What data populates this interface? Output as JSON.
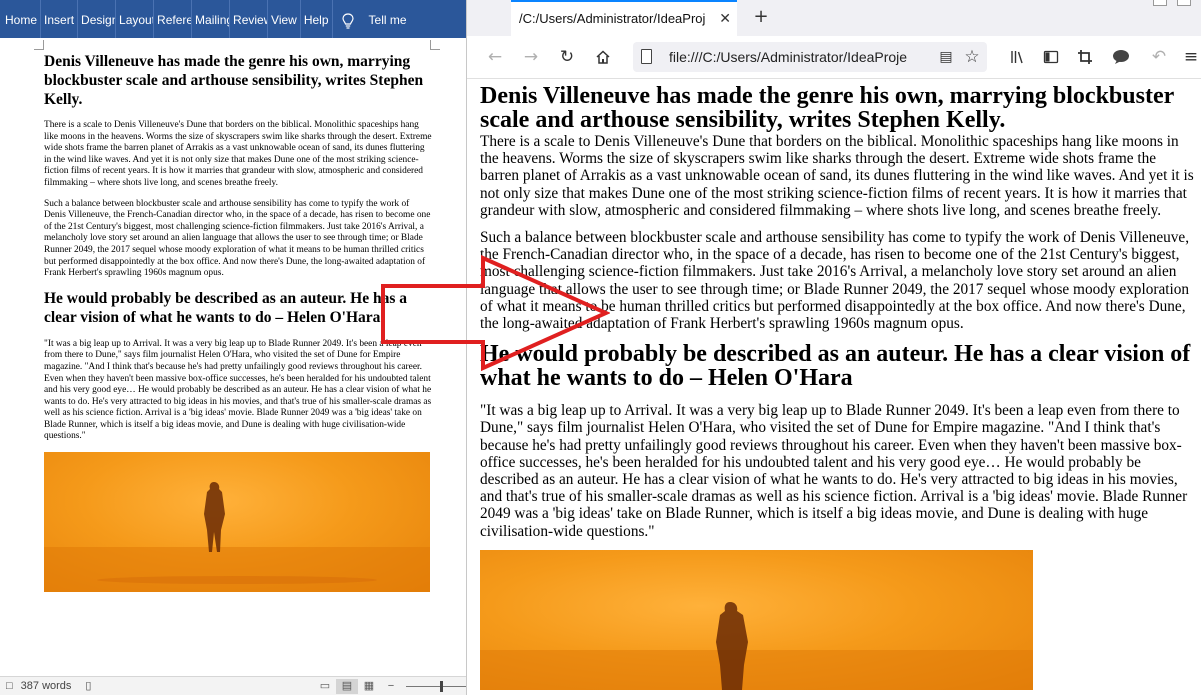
{
  "word": {
    "ribbon_tabs": [
      "Home",
      "Insert",
      "Design",
      "Layout",
      "References",
      "Mailings",
      "Review",
      "View",
      "Help"
    ],
    "tell_me": "Tell me",
    "heading1": "Denis Villeneuve has made the genre his own, marrying blockbuster scale and arthouse sensibility, writes Stephen Kelly.",
    "para1": "There is a scale to Denis Villeneuve's Dune that borders on the biblical. Monolithic spaceships hang like moons in the heavens. Worms the size of skyscrapers swim like sharks through the desert. Extreme wide shots frame the barren planet of Arrakis as a vast unknowable ocean of sand, its dunes fluttering in the wind like waves. And yet it is not only size that makes Dune one of the most striking science-fiction films of recent years. It is how it marries that grandeur with slow, atmospheric and considered filmmaking – where shots live long, and scenes breathe freely.",
    "para2": "Such a balance between blockbuster scale and arthouse sensibility has come to typify the work of Denis Villeneuve, the French-Canadian director who, in the space of a decade, has risen to become one of the 21st Century's biggest, most challenging science-fiction filmmakers. Just take 2016's Arrival, a melancholy love story set around an alien language that allows the user to see through time; or Blade Runner 2049, the 2017 sequel whose moody exploration of what it means to be human thrilled critics but performed disappointedly at the box office. And now there's Dune, the long-awaited adaptation of Frank Herbert's sprawling 1960s magnum opus.",
    "heading2": "He would probably be described as an auteur. He has a clear vision of what he wants to do – Helen O'Hara",
    "para3": "\"It was a big leap up to Arrival. It was a very big leap up to Blade Runner 2049. It's been a leap even from there to Dune,\" says film journalist Helen O'Hara, who visited the set of Dune for Empire magazine. \"And I think that's because he's had pretty unfailingly good reviews throughout his career. Even when they haven't been massive box-office successes, he's been heralded for his undoubted talent and his very good eye… He would probably be described as an auteur. He has a clear vision of what he wants to do. He's very attracted to big ideas in his movies, and that's true of his smaller-scale dramas as well as his science fiction. Arrival is a 'big ideas' movie. Blade Runner 2049 was a 'big ideas' take on Blade Runner, which is itself a big ideas movie, and Dune is dealing with huge civilisation-wide questions.\"",
    "status_words": "387 words"
  },
  "browser": {
    "tab_title": "/C:/Users/Administrator/IdeaProj",
    "tab_close": "✕",
    "new_tab": "+",
    "url": "file:///C:/Users/Administrator/IdeaProje",
    "heading1": "Denis Villeneuve has made the genre his own, marrying blockbuster scale and arthouse sensibility, writes Stephen Kelly.",
    "para1": "There is a scale to Denis Villeneuve's Dune that borders on the biblical. Monolithic spaceships hang like moons in the heavens. Worms the size of skyscrapers swim like sharks through the desert. Extreme wide shots frame the barren planet of Arrakis as a vast unknowable ocean of sand, its dunes fluttering in the wind like waves. And yet it is not only size that makes Dune one of the most striking science-fiction films of recent years. It is how it marries that grandeur with slow, atmospheric and considered filmmaking – where shots live long, and scenes breathe freely.",
    "para2": "Such a balance between blockbuster scale and arthouse sensibility has come to typify the work of Denis Villeneuve, the French-Canadian director who, in the space of a decade, has risen to become one of the 21st Century's biggest, most challenging science-fiction filmmakers. Just take 2016's Arrival, a melancholy love story set around an alien language that allows the user to see through time; or Blade Runner 2049, the 2017 sequel whose moody exploration of what it means to be human thrilled critics but performed disappointedly at the box office. And now there's Dune, the long-awaited adaptation of Frank Herbert's sprawling 1960s magnum opus.",
    "heading2": "He would probably be described as an auteur. He has a clear vision of what he wants to do – Helen O'Hara",
    "para3": "\"It was a big leap up to Arrival. It was a very big leap up to Blade Runner 2049. It's been a leap even from there to Dune,\" says film journalist Helen O'Hara, who visited the set of Dune for Empire magazine. \"And I think that's because he's had pretty unfailingly good reviews throughout his career. Even when they haven't been massive box-office successes, he's been heralded for his undoubted talent and his very good eye… He would probably be described as an auteur. He has a clear vision of what he wants to do. He's very attracted to big ideas in his movies, and that's true of his smaller-scale dramas as well as his science fiction. Arrival is a 'big ideas' movie. Blade Runner 2049 was a 'big ideas' take on Blade Runner, which is itself a big ideas movie, and Dune is dealing with huge civilisation-wide questions.\""
  },
  "icons": {
    "back": "back-arrow-icon",
    "forward": "forward-arrow-icon",
    "reload": "reload-icon",
    "home": "home-icon",
    "page": "page-icon",
    "reader": "reader-view-icon",
    "bookmark": "star-icon",
    "library": "library-icon",
    "sidebar": "sidebar-icon",
    "screenshot": "crop-icon",
    "chat": "speech-bubble-icon",
    "undo": "undo-icon",
    "menu": "hamburger-menu-icon",
    "lightbulb": "lightbulb-icon",
    "overlay": "red-arrow-icon"
  },
  "colors": {
    "word_ribbon": "#2b579a",
    "firefox_accent": "#0a84ff",
    "arrow": "#e02020",
    "image_orange": "#f59a1a"
  }
}
